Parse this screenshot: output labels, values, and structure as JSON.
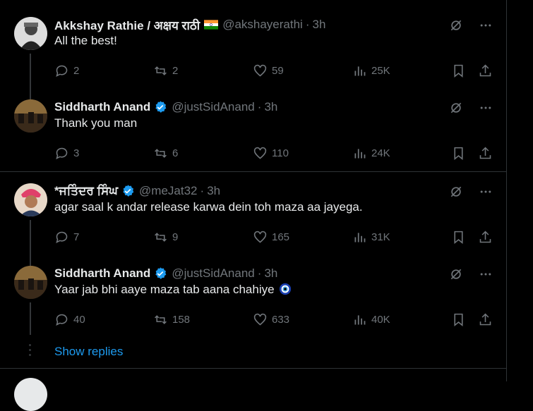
{
  "replies": [
    {
      "name": "Akkshay Rathie / अक्षय राठी",
      "handle": "@akshayerathi",
      "time": "3h",
      "text": "All the best!",
      "replies": "2",
      "reposts": "2",
      "likes": "59",
      "views": "25K",
      "avatar_desc": "person-photo-bw"
    },
    {
      "name": "Siddharth Anand",
      "handle": "@justSidAnand",
      "time": "3h",
      "text": "Thank you man",
      "replies": "3",
      "reposts": "6",
      "likes": "110",
      "views": "24K",
      "verified": true
    },
    {
      "name": "*ਜਤਿੰਦਰ ਸਿੰਘ",
      "handle": "@meJat32",
      "time": "3h",
      "text": "agar saal k andar release karwa dein toh maza aa jayega.",
      "replies": "7",
      "reposts": "9",
      "likes": "165",
      "views": "31K",
      "verified": true
    },
    {
      "name": "Siddharth Anand",
      "handle": "@justSidAnand",
      "time": "3h",
      "text": "Yaar jab bhi aaye maza tab aana chahiye",
      "replies": "40",
      "reposts": "158",
      "likes": "633",
      "views": "40K",
      "verified": true
    }
  ],
  "show_replies": "Show replies",
  "colors": {
    "verified": "#1d9bf0",
    "link": "#1d9bf0",
    "muted": "#71767b",
    "border": "#2f3336"
  },
  "icons": [
    "grok-icon",
    "more-icon",
    "reply-icon",
    "repost-icon",
    "like-icon",
    "views-icon",
    "bookmark-icon",
    "share-icon",
    "india-flag-icon",
    "nazar-emoji"
  ]
}
